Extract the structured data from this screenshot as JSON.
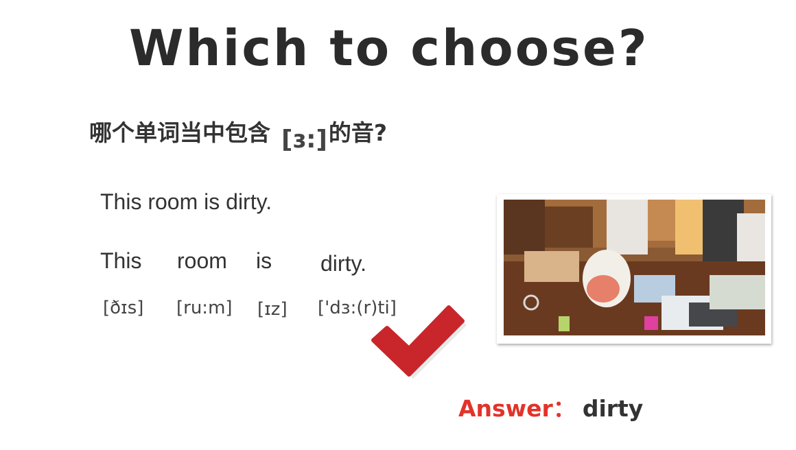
{
  "slide": {
    "title": "Which to choose?",
    "question": {
      "text_before": "哪个单词当中包含",
      "symbol": "[ɜ:]",
      "text_after": "的音?"
    },
    "sentence": "This room is dirty.",
    "words": [
      {
        "word": "This",
        "ipa": "[ðɪs]"
      },
      {
        "word": "room",
        "ipa": "[ru:m]"
      },
      {
        "word": "is",
        "ipa": "[ɪz]"
      },
      {
        "word": "dirty.",
        "ipa": "['dɜ:(r)ti]"
      }
    ],
    "answer": {
      "label": "Answer：",
      "value": "dirty"
    }
  },
  "colors": {
    "check": "#c8262b",
    "answer_label": "#e2332a",
    "text": "#333333"
  },
  "icons": {
    "checkmark": "check-icon"
  }
}
